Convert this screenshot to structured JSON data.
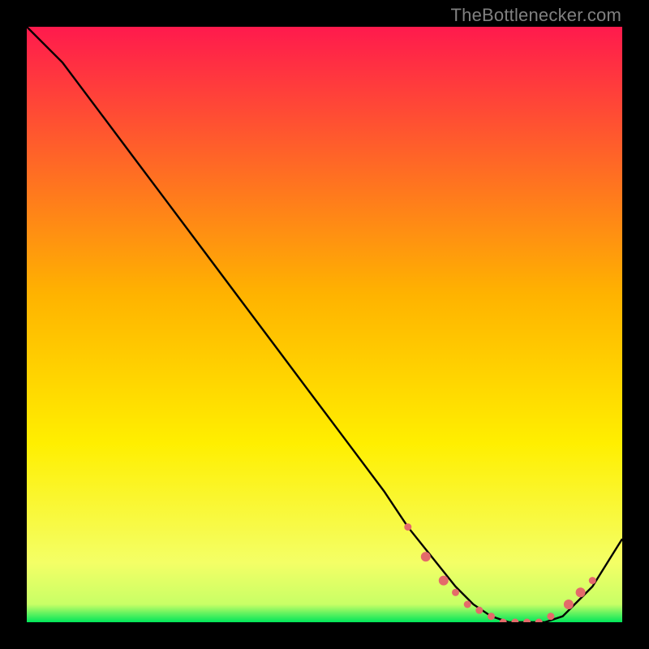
{
  "watermark": "TheBottlenecker.com",
  "chart_data": {
    "type": "line",
    "title": "",
    "xlabel": "",
    "ylabel": "",
    "xlim": [
      0,
      100
    ],
    "ylim": [
      0,
      100
    ],
    "gradient_stops": [
      {
        "offset": 0,
        "color": "#ff1a4d"
      },
      {
        "offset": 0.45,
        "color": "#ffb300"
      },
      {
        "offset": 0.7,
        "color": "#ffef00"
      },
      {
        "offset": 0.9,
        "color": "#f4ff66"
      },
      {
        "offset": 0.97,
        "color": "#c8ff66"
      },
      {
        "offset": 1.0,
        "color": "#00e65a"
      }
    ],
    "series": [
      {
        "name": "bottleneck-curve",
        "color": "#000000",
        "x": [
          0,
          6,
          12,
          18,
          24,
          30,
          36,
          42,
          48,
          54,
          60,
          64,
          68,
          72,
          75,
          78,
          81,
          84,
          87,
          90,
          92,
          95,
          100
        ],
        "y": [
          100,
          94,
          86,
          78,
          70,
          62,
          54,
          46,
          38,
          30,
          22,
          16,
          11,
          6,
          3,
          1,
          0,
          0,
          0,
          1,
          3,
          6,
          14
        ]
      }
    ],
    "markers": {
      "name": "valley-points",
      "color": "#e46a6a",
      "radius_small": 4.5,
      "radius_large": 6.0,
      "points": [
        {
          "x": 64,
          "y": 16,
          "r": "small"
        },
        {
          "x": 67,
          "y": 11,
          "r": "large"
        },
        {
          "x": 70,
          "y": 7,
          "r": "large"
        },
        {
          "x": 72,
          "y": 5,
          "r": "small"
        },
        {
          "x": 74,
          "y": 3,
          "r": "small"
        },
        {
          "x": 76,
          "y": 2,
          "r": "small"
        },
        {
          "x": 78,
          "y": 1,
          "r": "small"
        },
        {
          "x": 80,
          "y": 0,
          "r": "small"
        },
        {
          "x": 82,
          "y": 0,
          "r": "small"
        },
        {
          "x": 84,
          "y": 0,
          "r": "small"
        },
        {
          "x": 86,
          "y": 0,
          "r": "small"
        },
        {
          "x": 88,
          "y": 1,
          "r": "small"
        },
        {
          "x": 91,
          "y": 3,
          "r": "large"
        },
        {
          "x": 93,
          "y": 5,
          "r": "large"
        },
        {
          "x": 95,
          "y": 7,
          "r": "small"
        }
      ]
    }
  }
}
